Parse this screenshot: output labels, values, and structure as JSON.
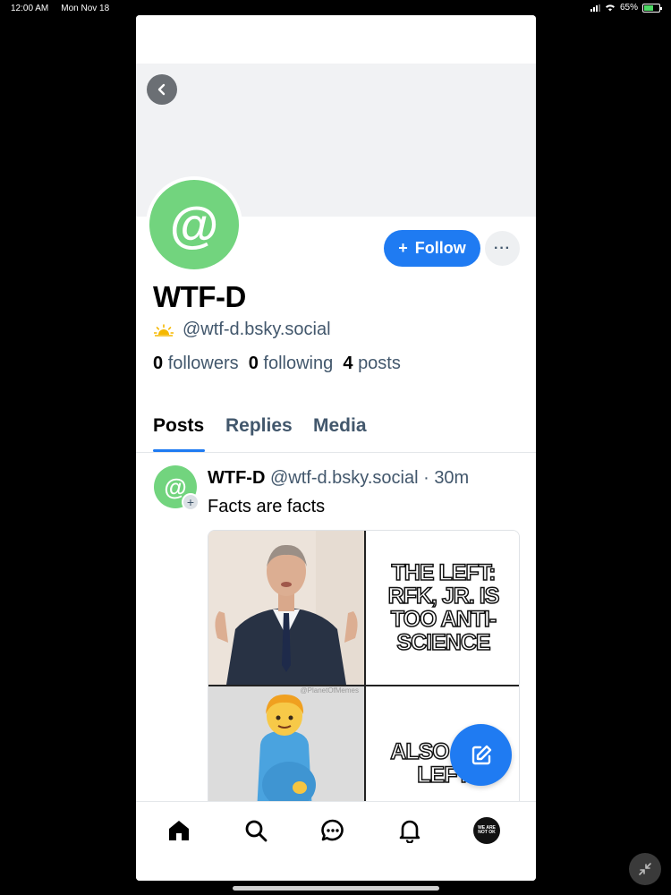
{
  "status_bar": {
    "time": "12:00 AM",
    "date": "Mon Nov 18",
    "battery": "65%",
    "battery_level": 0.65
  },
  "profile": {
    "display_name": "WTF-D",
    "handle": "@wtf-d.bsky.social",
    "avatar_glyph": "@",
    "follow_label": "Follow",
    "follow_icon": "+",
    "more_label": "···",
    "stats": {
      "followers_count": "0",
      "followers_label": "followers",
      "following_count": "0",
      "following_label": "following",
      "posts_count": "4",
      "posts_label": "posts"
    }
  },
  "tabs": [
    {
      "label": "Posts",
      "active": true
    },
    {
      "label": "Replies",
      "active": false
    },
    {
      "label": "Media",
      "active": false
    }
  ],
  "post": {
    "author": "WTF-D",
    "handle": "@wtf-d.bsky.social",
    "separator": "·",
    "time": "30m",
    "text": "Facts are facts",
    "meme": {
      "caption_top": "THE LEFT: RFK, JR. IS TOO ANTI-SCIENCE",
      "caption_bottom": "ALSO THE LEFT",
      "watermark": "@PlanetOfMemes"
    }
  },
  "nav": {
    "items": [
      "home-icon",
      "search-icon",
      "chat-icon",
      "bell-icon",
      "profile-avatar"
    ],
    "avatar_text": "WE ARE NOT OK"
  },
  "colors": {
    "accent": "#1f7bf2",
    "avatar_green": "#72d47e",
    "muted": "#42576c"
  }
}
